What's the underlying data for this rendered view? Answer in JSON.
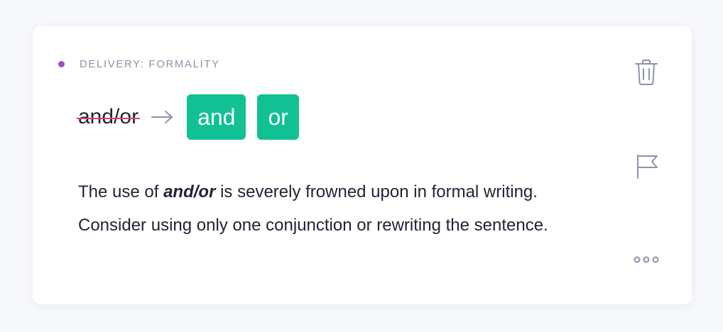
{
  "card": {
    "category": "DELIVERY: FORMALITY",
    "original_text": "and/or",
    "suggestions": [
      "and",
      "or"
    ],
    "explanation": {
      "prefix": "The use of ",
      "emphasis": "and/or",
      "suffix": " is severely frowned upon in formal writing. Consider using only one conjunction or rewriting the sentence."
    }
  },
  "icons": {
    "category_dot": "dot-indicator",
    "arrow": "arrow-right-icon",
    "delete": "trash-icon",
    "flag": "flag-icon",
    "more": "more-horizontal-icon"
  },
  "colors": {
    "accent_dot": "#9a4fc4",
    "suggestion_bg": "#11c194",
    "strike": "#e0425e",
    "muted": "#8d92a8",
    "text": "#1f2433"
  }
}
